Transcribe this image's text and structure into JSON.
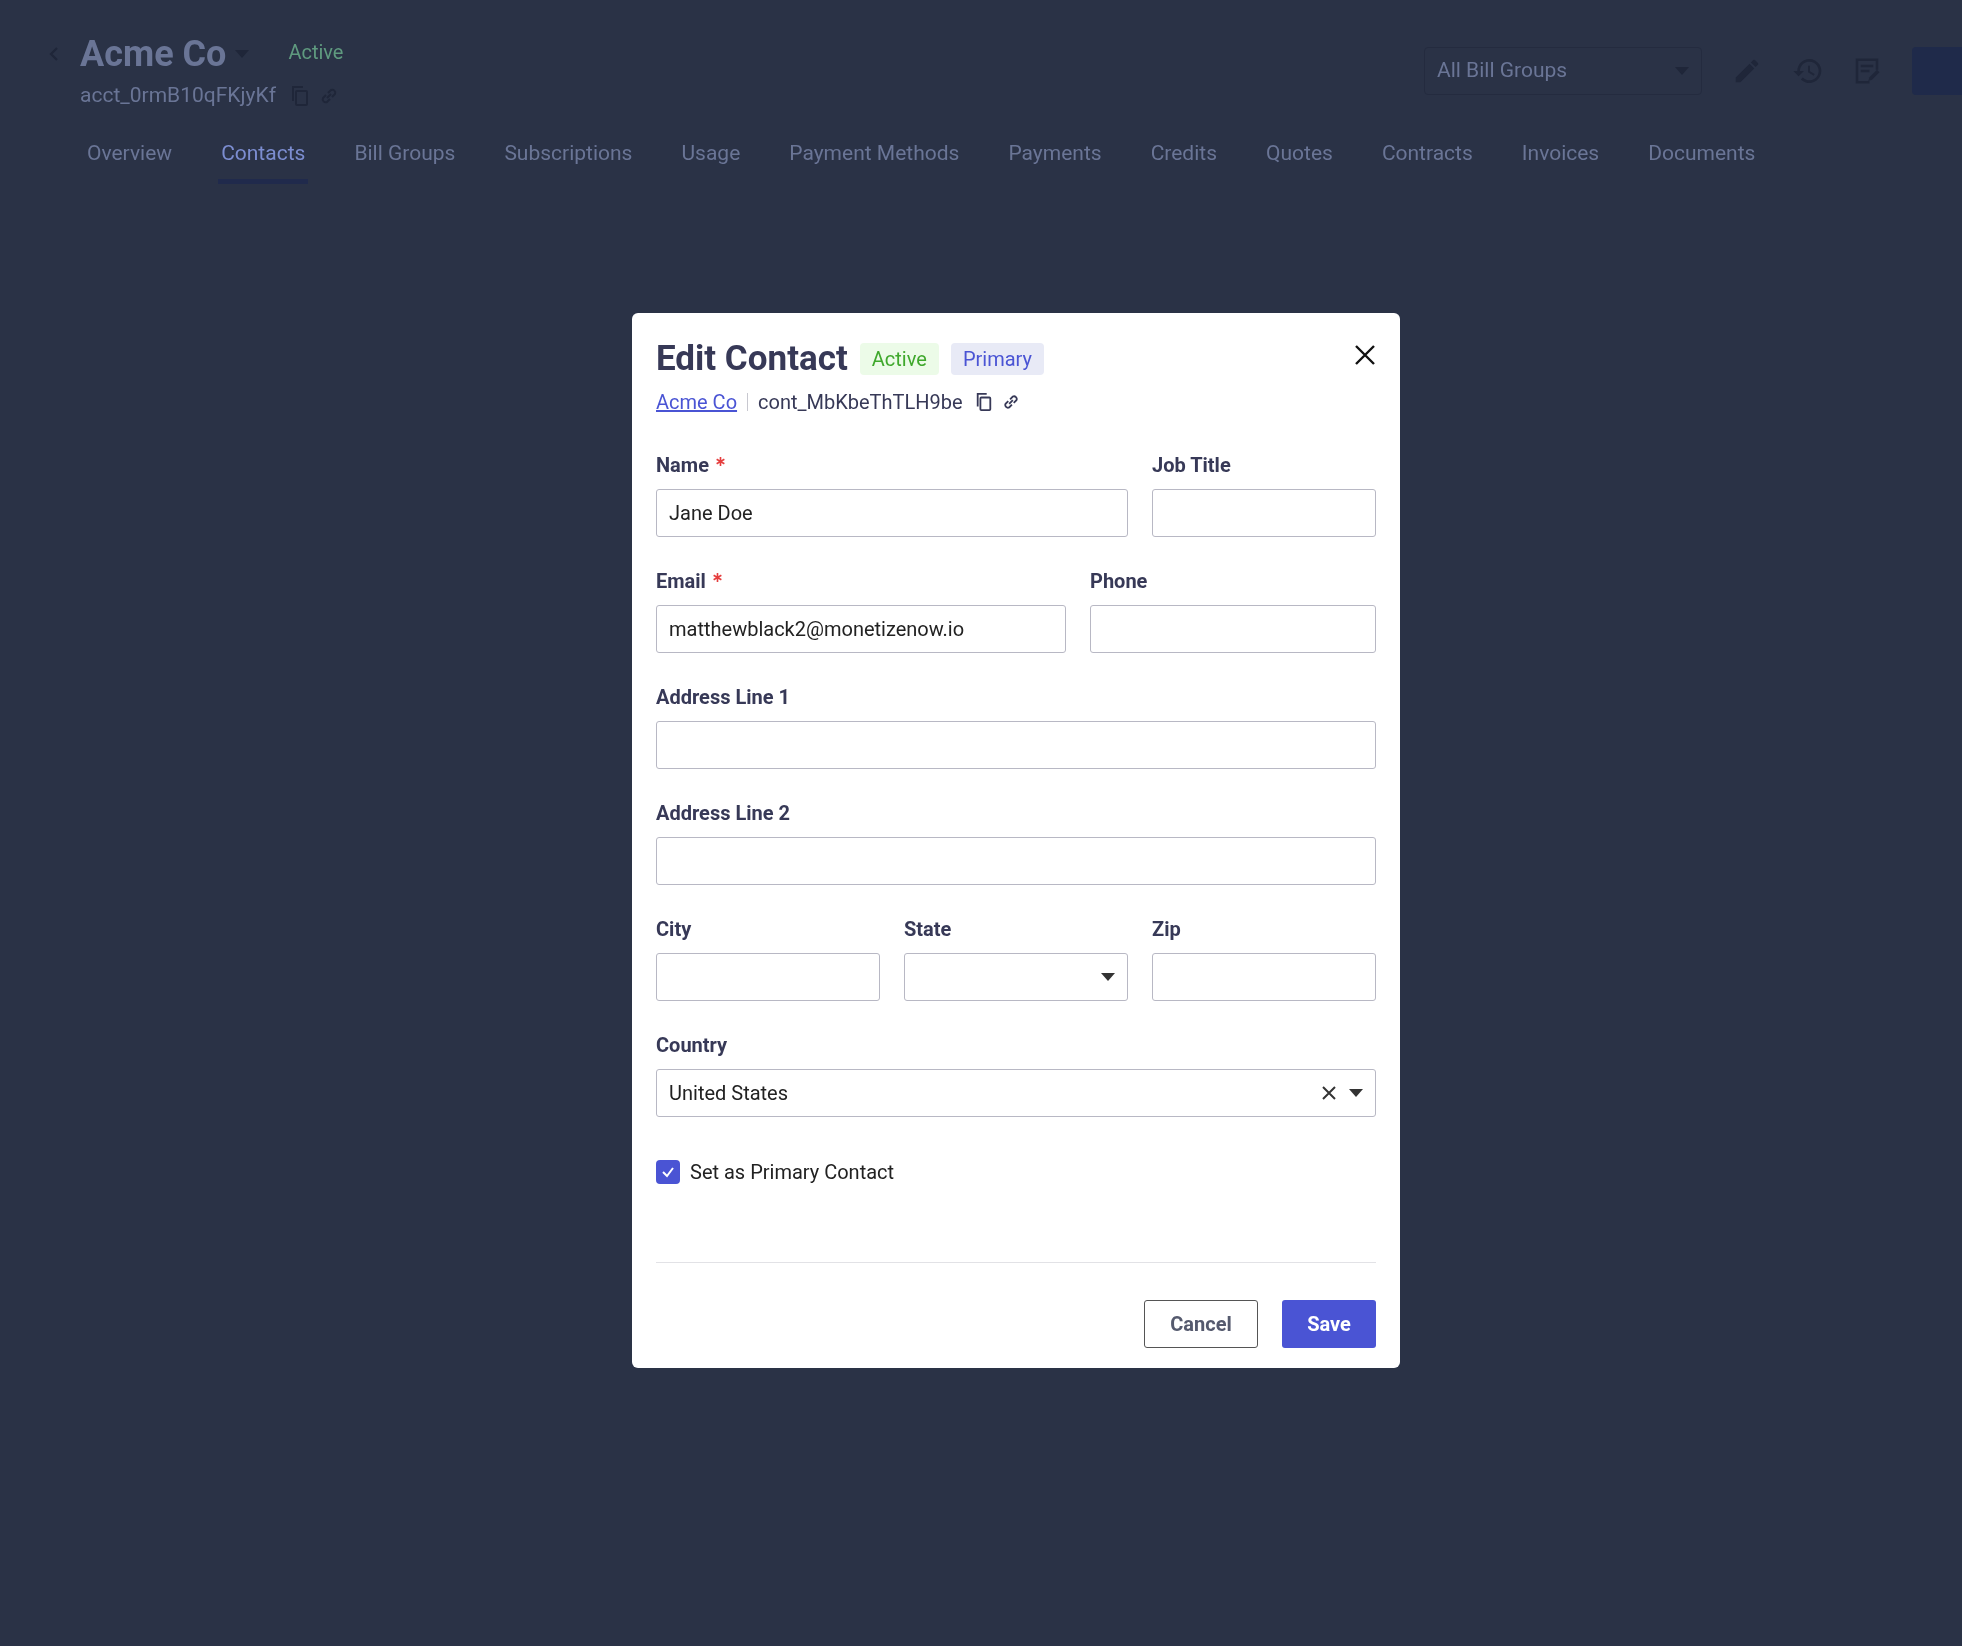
{
  "account": {
    "name": "Acme Co",
    "status": "Active",
    "id": "acct_0rmB10qFKjyKf"
  },
  "tabs": [
    {
      "label": "Overview",
      "selected": false
    },
    {
      "label": "Contacts",
      "selected": true
    },
    {
      "label": "Bill Groups",
      "selected": false
    },
    {
      "label": "Subscriptions",
      "selected": false
    },
    {
      "label": "Usage",
      "selected": false
    },
    {
      "label": "Payment Methods",
      "selected": false
    },
    {
      "label": "Payments",
      "selected": false
    },
    {
      "label": "Credits",
      "selected": false
    },
    {
      "label": "Quotes",
      "selected": false
    },
    {
      "label": "Contracts",
      "selected": false
    },
    {
      "label": "Invoices",
      "selected": false
    },
    {
      "label": "Documents",
      "selected": false
    }
  ],
  "bill_group_select": {
    "placeholder": "All Bill Groups"
  },
  "dialog": {
    "title": "Edit Contact",
    "badges": [
      {
        "label": "Active",
        "kind": "status"
      },
      {
        "label": "Primary",
        "kind": "role"
      }
    ],
    "account_link": "Acme Co",
    "contact_id": "cont_MbKbeThTLH9be",
    "fields": [
      {
        "label": "Name",
        "required": true,
        "value": "Jane Doe",
        "kind": "text"
      },
      {
        "label": "Job Title",
        "required": false,
        "kind": "text"
      },
      {
        "label": "Email",
        "required": true,
        "value": "matthewblack2@monetizenow.io",
        "kind": "text"
      },
      {
        "label": "Phone",
        "required": false,
        "kind": "text"
      },
      {
        "label": "Address Line 1",
        "required": false,
        "kind": "text"
      },
      {
        "label": "Address Line 2",
        "required": false,
        "kind": "text"
      },
      {
        "label": "City",
        "required": false,
        "kind": "text"
      },
      {
        "label": "State",
        "required": false,
        "kind": "select"
      },
      {
        "label": "Zip",
        "required": false,
        "kind": "text"
      },
      {
        "label": "Country",
        "required": false,
        "value": "United States",
        "kind": "combobox"
      }
    ],
    "primary_checkbox": {
      "label": "Set as Primary Contact",
      "checked": true
    },
    "buttons": [
      {
        "label": "Cancel",
        "kind": "secondary"
      },
      {
        "label": "Save",
        "kind": "primary"
      }
    ]
  }
}
